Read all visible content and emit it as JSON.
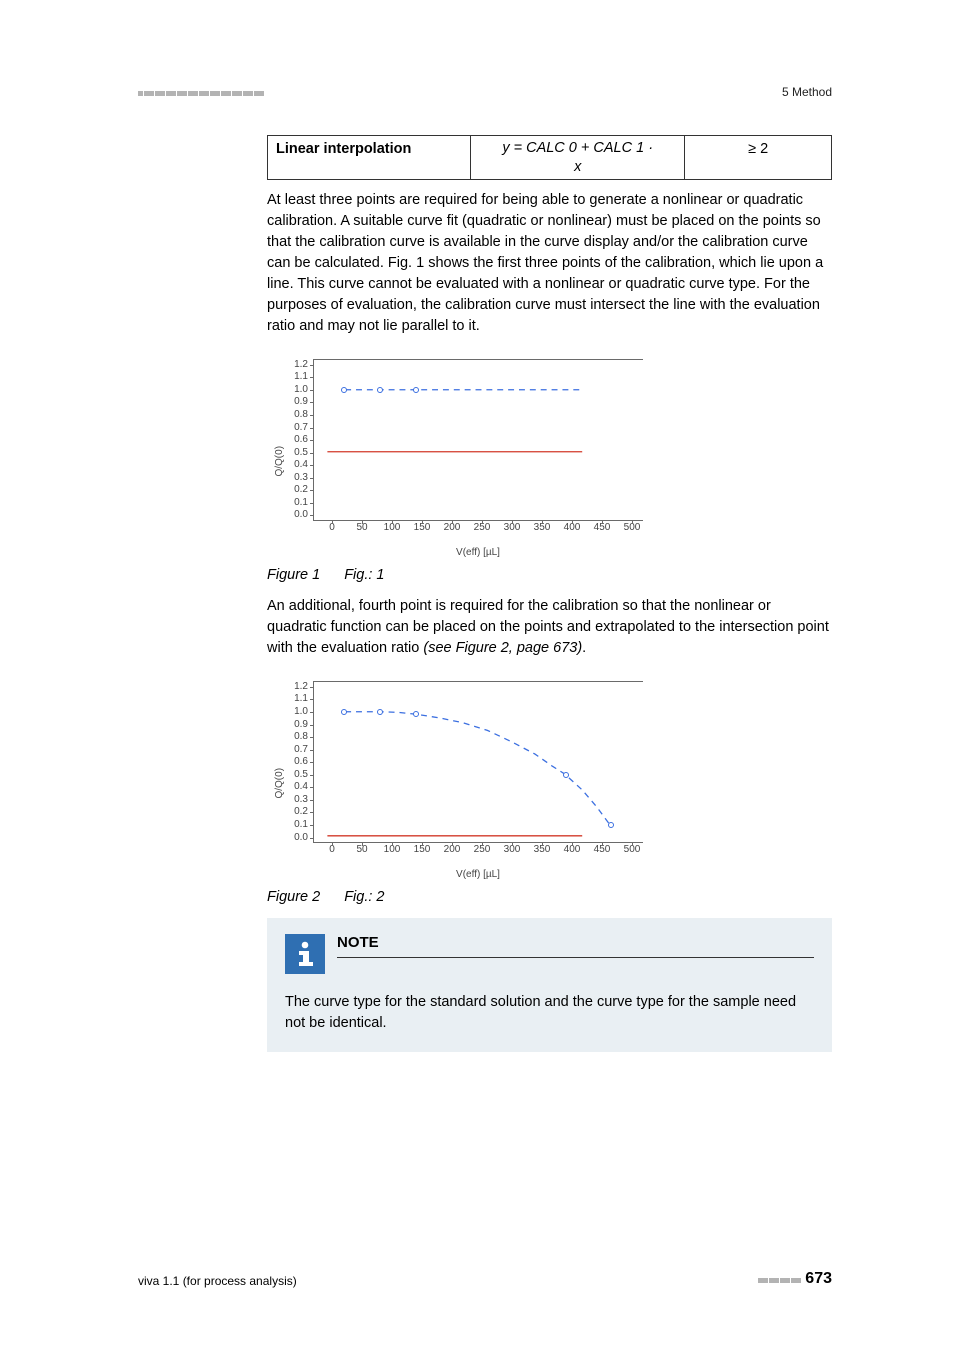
{
  "header": {
    "section": "5 Method"
  },
  "table": {
    "col1": "Linear interpolation",
    "col2_line1": "y = CALC 0 + CALC 1 ·",
    "col2_line2": "x",
    "col3": "≥ 2"
  },
  "para1": "At least three points are required for being able to generate a nonlinear or quadratic calibration. A suitable curve fit (quadratic or nonlinear) must be placed on the points so that the calibration curve is available in the curve display and/or the calibration curve can be calculated. Fig. 1 shows the first three points of the calibration, which lie upon a line. This curve cannot be evaluated with a nonlinear or quadratic curve type. For the purposes of evaluation, the calibration curve must intersect the line with the evaluation ratio and may not lie parallel to it.",
  "fig1_caption_a": "Figure 1",
  "fig1_caption_b": "Fig.: 1",
  "para2_a": "An additional, fourth point is required for the calibration so that the nonlinear or quadratic function can be placed on the points and extrapolated to the intersection point with the evaluation ratio ",
  "para2_ref": "(see Figure 2, page 673)",
  "para2_b": ".",
  "fig2_caption_a": "Figure 2",
  "fig2_caption_b": "Fig.: 2",
  "chart_data": [
    {
      "type": "line",
      "title": "",
      "xlabel": "V(eff) [µL]",
      "ylabel": "Q/Q(0)",
      "xlim": [
        -30,
        520
      ],
      "ylim": [
        -0.05,
        1.24
      ],
      "xticks": [
        0,
        50,
        100,
        150,
        200,
        250,
        300,
        350,
        400,
        450,
        500
      ],
      "yticks": [
        0.0,
        0.1,
        0.2,
        0.3,
        0.4,
        0.5,
        0.6,
        0.7,
        0.8,
        0.9,
        1.0,
        1.1,
        1.2
      ],
      "series": [
        {
          "name": "evaluation-ratio-line",
          "style": "solid-red",
          "points": [
            [
              -10,
              0.5
            ],
            [
              420,
              0.5
            ]
          ]
        },
        {
          "name": "calibration-line",
          "style": "dashed-blue",
          "points": [
            [
              20,
              1.0
            ],
            [
              420,
              1.0
            ]
          ]
        },
        {
          "name": "data-points",
          "style": "marker-blue",
          "points": [
            [
              20,
              1.0
            ],
            [
              80,
              1.0
            ],
            [
              140,
              1.0
            ]
          ]
        }
      ]
    },
    {
      "type": "line",
      "title": "",
      "xlabel": "V(eff) [µL]",
      "ylabel": "Q/Q(0)",
      "xlim": [
        -30,
        520
      ],
      "ylim": [
        -0.05,
        1.24
      ],
      "xticks": [
        0,
        50,
        100,
        150,
        200,
        250,
        300,
        350,
        400,
        450,
        500
      ],
      "yticks": [
        0.0,
        0.1,
        0.2,
        0.3,
        0.4,
        0.5,
        0.6,
        0.7,
        0.8,
        0.9,
        1.0,
        1.1,
        1.2
      ],
      "series": [
        {
          "name": "evaluation-ratio-line",
          "style": "solid-red",
          "points": [
            [
              -10,
              0.0
            ],
            [
              420,
              0.0
            ]
          ]
        },
        {
          "name": "data-points",
          "style": "marker-blue",
          "points": [
            [
              20,
              1.0
            ],
            [
              80,
              1.0
            ],
            [
              140,
              0.98
            ],
            [
              390,
              0.5
            ],
            [
              465,
              0.1
            ]
          ]
        },
        {
          "name": "calibration-curve",
          "style": "dashed-blue",
          "points": [
            [
              20,
              1.0
            ],
            [
              80,
              1.0
            ],
            [
              110,
              0.995
            ],
            [
              140,
              0.98
            ],
            [
              180,
              0.95
            ],
            [
              220,
              0.91
            ],
            [
              260,
              0.85
            ],
            [
              300,
              0.76
            ],
            [
              340,
              0.66
            ],
            [
              370,
              0.56
            ],
            [
              390,
              0.5
            ],
            [
              420,
              0.37
            ],
            [
              445,
              0.23
            ],
            [
              465,
              0.1
            ]
          ]
        }
      ]
    }
  ],
  "note": {
    "title": "NOTE",
    "body": "The curve type for the standard solution and the curve type for the sample need not be identical."
  },
  "footer": {
    "product": "viva 1.1 (for process analysis)",
    "page": "673"
  }
}
